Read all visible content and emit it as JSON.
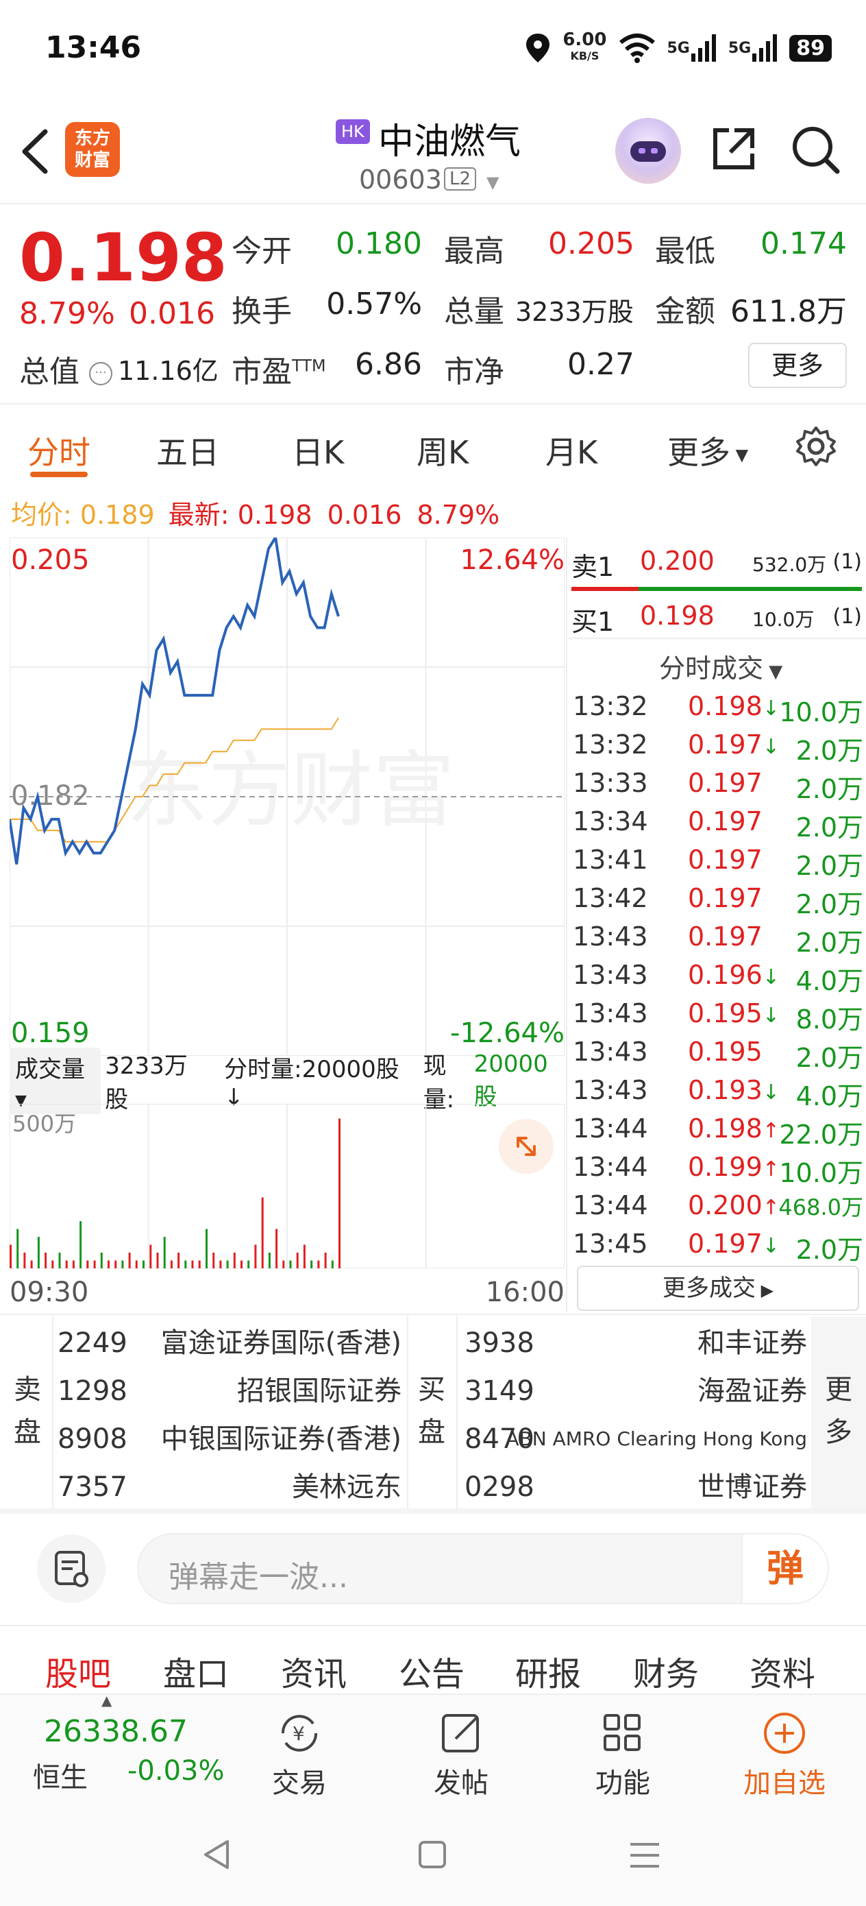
{
  "status_bar": {
    "time": "13:46",
    "net_speed": "6.00",
    "net_unit": "KB/S",
    "signal1": "5G",
    "signal2": "5G",
    "battery": "89"
  },
  "header": {
    "logo_text_line1": "东方",
    "logo_text_line2": "财富",
    "market_badge": "HK",
    "stock_name": "中油燃气",
    "stock_code": "00603",
    "level_badge": "L2"
  },
  "quote": {
    "price": "0.198",
    "change_pct": "8.79%",
    "change_amt": "0.016",
    "open_label": "今开",
    "open": "0.180",
    "high_label": "最高",
    "high": "0.205",
    "low_label": "最低",
    "low": "0.174",
    "turnover_label": "换手",
    "turnover": "0.57%",
    "volume_label": "总量",
    "volume": "3233万股",
    "amount_label": "金额",
    "amount": "611.8万",
    "mktcap_label": "总值",
    "mktcap": "11.16亿",
    "pe_label": "市盈",
    "pe_sup": "TTM",
    "pe": "6.86",
    "pb_label": "市净",
    "pb": "0.27",
    "more": "更多"
  },
  "chart_tabs": [
    "分时",
    "五日",
    "日K",
    "周K",
    "月K",
    "更多"
  ],
  "avg_info": {
    "avg_label": "均价:",
    "avg": "0.189",
    "latest_label": "最新:",
    "latest": "0.198",
    "chg": "0.016",
    "pct": "8.79%"
  },
  "chart_labels": {
    "top_price": "0.205",
    "top_pct": "12.64%",
    "mid_price": "0.182",
    "bottom_price": "0.159",
    "bottom_pct": "-12.64%",
    "watermark": "东方财富",
    "vol_selector": "成交量",
    "vol_total": "3233万股",
    "vol_minute": "分时量:20000股↓",
    "vol_now_label": "现量:",
    "vol_now": "20000股",
    "vol_axis": "500万",
    "time_start": "09:30",
    "time_end": "16:00"
  },
  "chart_data": {
    "type": "line",
    "ylim": [
      0.159,
      0.205
    ],
    "series": [
      {
        "values": [
          0.18,
          0.176,
          0.181,
          0.18,
          0.182,
          0.179,
          0.18,
          0.18,
          0.177,
          0.178,
          0.177,
          0.178,
          0.177,
          0.177,
          0.178,
          0.179,
          0.182,
          0.185,
          0.188,
          0.192,
          0.191,
          0.195,
          0.196,
          0.193,
          0.194,
          0.191,
          0.191,
          0.191,
          0.191,
          0.191,
          0.195,
          0.197,
          0.198,
          0.197,
          0.199,
          0.198,
          0.201,
          0.204,
          0.205,
          0.201,
          0.202,
          0.2,
          0.201,
          0.198,
          0.197,
          0.197,
          0.2,
          0.198
        ]
      },
      {
        "values": [
          0.18,
          0.18,
          0.18,
          0.18,
          0.179,
          0.179,
          0.179,
          0.179,
          0.178,
          0.178,
          0.178,
          0.178,
          0.178,
          0.178,
          0.178,
          0.179,
          0.18,
          0.181,
          0.182,
          0.182,
          0.183,
          0.183,
          0.184,
          0.184,
          0.184,
          0.185,
          0.185,
          0.185,
          0.185,
          0.186,
          0.186,
          0.186,
          0.187,
          0.187,
          0.187,
          0.187,
          0.188,
          0.188,
          0.188,
          0.188,
          0.188,
          0.188,
          0.188,
          0.188,
          0.188,
          0.188,
          0.188,
          0.189
        ]
      }
    ],
    "volume": [
      3,
      5,
      2,
      1,
      4,
      2,
      1,
      2,
      1,
      1,
      6,
      1,
      1,
      2,
      1,
      1,
      1,
      2,
      1,
      1,
      3,
      2,
      4,
      1,
      2,
      1,
      1,
      1,
      5,
      2,
      1,
      1,
      2,
      1,
      1,
      3,
      9,
      2,
      5,
      1,
      1,
      2,
      3,
      1,
      1,
      2,
      1,
      19
    ]
  },
  "order_book": {
    "ask_label": "卖1",
    "ask_price": "0.200",
    "ask_vol": "532.0万",
    "ask_cnt": "(1)",
    "bid_label": "买1",
    "bid_price": "0.198",
    "bid_vol": "10.0万",
    "bid_cnt": "(1)",
    "trades_title": "分时成交",
    "trades": [
      {
        "t": "13:32",
        "p": "0.198",
        "a": "↓",
        "v": "10.0万"
      },
      {
        "t": "13:32",
        "p": "0.197",
        "a": "↓",
        "v": "2.0万"
      },
      {
        "t": "13:33",
        "p": "0.197",
        "a": "",
        "v": "2.0万"
      },
      {
        "t": "13:34",
        "p": "0.197",
        "a": "",
        "v": "2.0万"
      },
      {
        "t": "13:41",
        "p": "0.197",
        "a": "",
        "v": "2.0万"
      },
      {
        "t": "13:42",
        "p": "0.197",
        "a": "",
        "v": "2.0万"
      },
      {
        "t": "13:43",
        "p": "0.197",
        "a": "",
        "v": "2.0万"
      },
      {
        "t": "13:43",
        "p": "0.196",
        "a": "↓",
        "v": "4.0万"
      },
      {
        "t": "13:43",
        "p": "0.195",
        "a": "↓",
        "v": "8.0万"
      },
      {
        "t": "13:43",
        "p": "0.195",
        "a": "",
        "v": "2.0万"
      },
      {
        "t": "13:43",
        "p": "0.193",
        "a": "↓",
        "v": "4.0万"
      },
      {
        "t": "13:44",
        "p": "0.198",
        "a": "↑",
        "v": "22.0万"
      },
      {
        "t": "13:44",
        "p": "0.199",
        "a": "↑",
        "v": "10.0万"
      },
      {
        "t": "13:44",
        "p": "0.200",
        "a": "↑",
        "v": "468.0万"
      },
      {
        "t": "13:45",
        "p": "0.197",
        "a": "↓",
        "v": "2.0万"
      }
    ],
    "more_trades": "更多成交"
  },
  "brokers": {
    "sell_label": [
      "卖",
      "盘"
    ],
    "buy_label": [
      "买",
      "盘"
    ],
    "more_label": [
      "更",
      "多"
    ],
    "sell": [
      {
        "code": "2249",
        "name": "富途证券国际(香港)"
      },
      {
        "code": "1298",
        "name": "招银国际证券"
      },
      {
        "code": "8908",
        "name": "中银国际证券(香港)"
      },
      {
        "code": "7357",
        "name": "美林远东"
      }
    ],
    "buy": [
      {
        "code": "3938",
        "name": "和丰证券"
      },
      {
        "code": "3149",
        "name": "海盈证券"
      },
      {
        "code": "8470",
        "name": "ABN AMRO Clearing Hong Kong"
      },
      {
        "code": "0298",
        "name": "世博证券"
      }
    ]
  },
  "danmu": {
    "placeholder": "弹幕走一波...",
    "send": "弹"
  },
  "news_tabs": [
    "股吧",
    "盘口",
    "资讯",
    "公告",
    "研报",
    "财务",
    "资料"
  ],
  "footer": {
    "index_value": "26338.67",
    "index_name": "恒生",
    "index_change": "-0.03%",
    "buttons": [
      "交易",
      "发帖",
      "功能",
      "加自选"
    ]
  },
  "colors": {
    "up": "#e02020",
    "down": "#15961e",
    "accent": "#e8641a",
    "price_line": "#2a62b8",
    "avg_line": "#f0a830"
  }
}
